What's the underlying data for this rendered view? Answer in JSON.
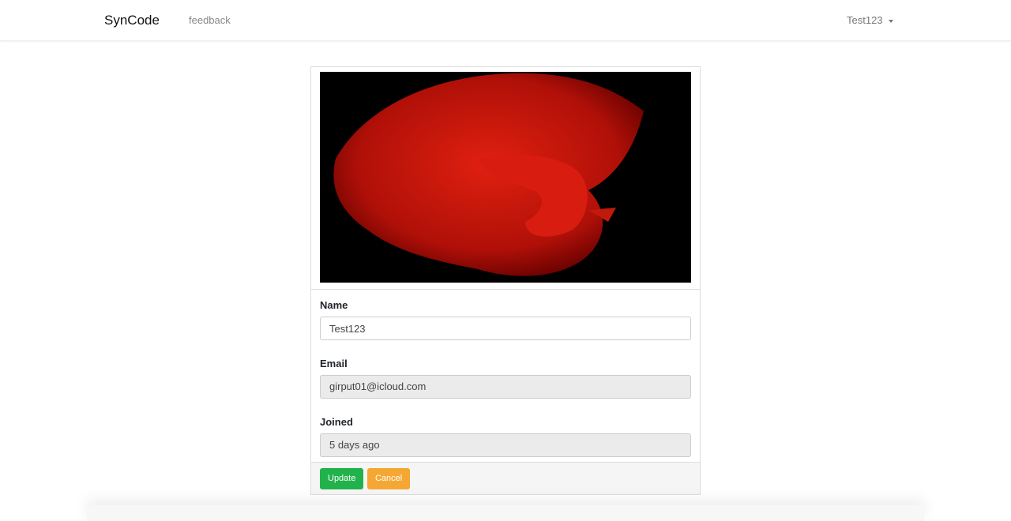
{
  "nav": {
    "brand": "SynCode",
    "feedback": "feedback",
    "user": "Test123"
  },
  "profile": {
    "name_label": "Name",
    "name_value": "Test123",
    "email_label": "Email",
    "email_value": "girput01@icloud.com",
    "joined_label": "Joined",
    "joined_value": "5 days ago",
    "update_label": "Update",
    "cancel_label": "Cancel"
  }
}
